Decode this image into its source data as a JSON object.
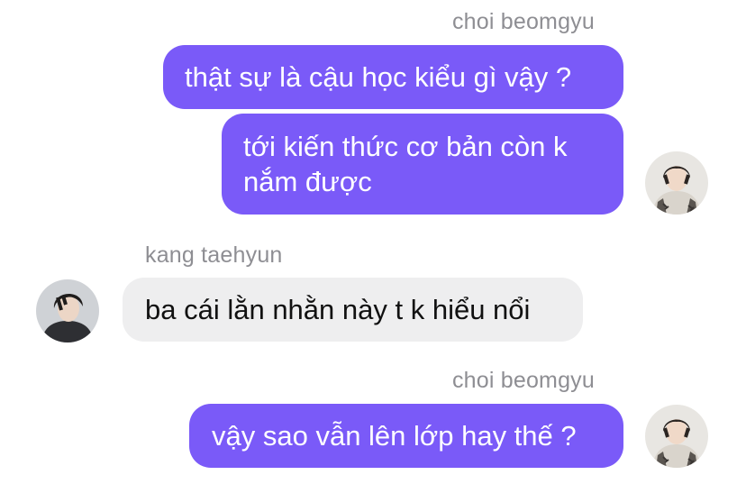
{
  "messages": [
    {
      "sender": "choi beomgyu",
      "direction": "outgoing",
      "bubbles": [
        "thật sự là cậu học kiểu gì vậy ?",
        "tới kiến thức cơ bản còn k nắm được"
      ]
    },
    {
      "sender": "kang taehyun",
      "direction": "incoming",
      "bubbles": [
        "ba cái lằn nhằn này t k hiểu nổi"
      ]
    },
    {
      "sender": "choi beomgyu",
      "direction": "outgoing",
      "bubbles": [
        "vậy sao vẫn lên lớp hay thế ?"
      ]
    }
  ],
  "wrapped_lines": {
    "beomgyu_msg_2": [
      "tới kiến thức cơ bản còn k",
      "nắm được"
    ]
  },
  "colors": {
    "outgoing_bubble": "#7a5af8",
    "incoming_bubble": "#eeeeef",
    "sender_name": "#8e8e93"
  }
}
